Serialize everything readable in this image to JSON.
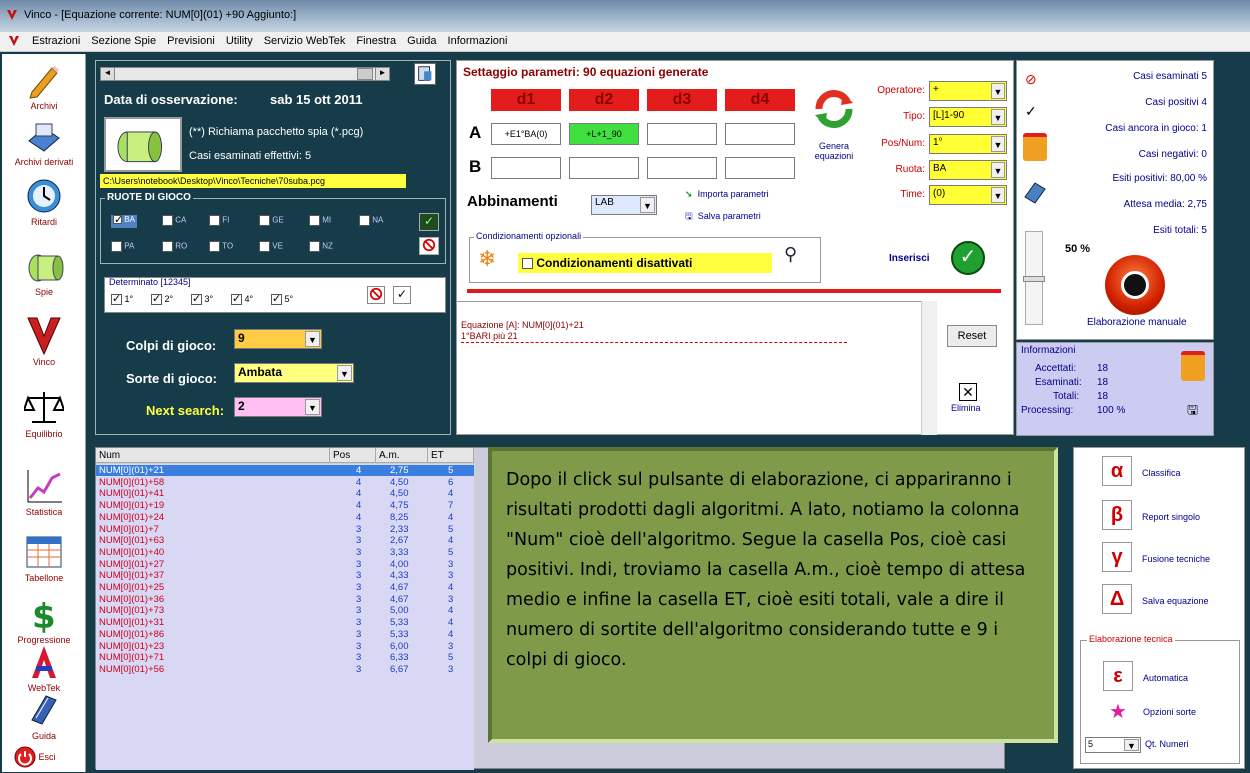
{
  "window": {
    "title": "Vinco - [Equazione corrente: NUM[0](01) +90 Aggiunto:]"
  },
  "menu": [
    "Estrazioni",
    "Sezione Spie",
    "Previsioni",
    "Utility",
    "Servizio WebTek",
    "Finestra",
    "Guida",
    "Informazioni"
  ],
  "sidebar": [
    {
      "label": "Archivi",
      "icon": "pencil-icon"
    },
    {
      "label": "Archivi derivati",
      "icon": "archive-icon"
    },
    {
      "label": "Ritardi",
      "icon": "clock-icon"
    },
    {
      "label": "Spie",
      "icon": "spy-icon"
    },
    {
      "label": "Vinco",
      "icon": "vinco-icon"
    },
    {
      "label": "Equilibrio",
      "icon": "scale-icon"
    },
    {
      "label": "Statistica",
      "icon": "chart-icon"
    },
    {
      "label": "Tabellone",
      "icon": "table-icon"
    },
    {
      "label": "Progressione",
      "icon": "dollar-icon"
    },
    {
      "label": "WebTek",
      "icon": "webtek-icon"
    },
    {
      "label": "Guida",
      "icon": "guide-icon"
    },
    {
      "label": "Esci",
      "icon": "exit-icon"
    }
  ],
  "observation": {
    "date_label": "Data di osservazione:",
    "date_value": "sab 15 ott 2011",
    "spy_pack": "(**) Richiama pacchetto spia (*.pcg)",
    "cases_examined": "Casi esaminati effettivi: 5",
    "path": "C:\\Users\\notebook\\Desktop\\Vinco\\Tecniche\\70suba.pcg",
    "ruote_title": "RUOTE DI GIOCO",
    "ruote": [
      {
        "name": "BA",
        "checked": true
      },
      {
        "name": "CA",
        "checked": false
      },
      {
        "name": "FI",
        "checked": false
      },
      {
        "name": "GE",
        "checked": false
      },
      {
        "name": "MI",
        "checked": false
      },
      {
        "name": "NA",
        "checked": false
      },
      {
        "name": "PA",
        "checked": false
      },
      {
        "name": "RO",
        "checked": false
      },
      {
        "name": "TO",
        "checked": false
      },
      {
        "name": "VE",
        "checked": false
      },
      {
        "name": "NZ",
        "checked": false
      }
    ],
    "determinato_title": "Determinato [12345]",
    "determinato": [
      "1°",
      "2°",
      "3°",
      "4°",
      "5°"
    ],
    "colpi_label": "Colpi di gioco:",
    "colpi_value": "9",
    "sorte_label": "Sorte di gioco:",
    "sorte_value": "Ambata",
    "next_label": "Next search:",
    "next_value": "2"
  },
  "settaggio": {
    "title": "Settaggio parametri: 90 equazioni generate",
    "headers": [
      "d1",
      "d2",
      "d3",
      "d4"
    ],
    "row_a_label": "A",
    "row_b_label": "B",
    "row_a": [
      "+E1°BA(0)",
      "+L+1_90",
      "",
      ""
    ],
    "genera": "Genera equazioni",
    "operatore_label": "Operatore:",
    "operatore_value": "+",
    "tipo_label": "Tipo:",
    "tipo_value": "[L]1-90",
    "posnum_label": "Pos/Num:",
    "posnum_value": "1°",
    "ruota_label": "Ruota:",
    "ruota_value": "BA",
    "time_label": "Time:",
    "time_value": "(0)",
    "abbinamenti_label": "Abbinamenti",
    "abbinamenti_value": "LAB",
    "importa": "Importa parametri",
    "salva": "Salva parametri",
    "cond_title": "Condizionamenti opzionali",
    "cond_label": "Condizionamenti disattivati",
    "inserisci": "Inserisci",
    "equation_line1": "Equazione [A]: NUM[0](01)+21",
    "equation_line2": "1°BARI  più 21",
    "reset": "Reset",
    "elimina": "Elimina"
  },
  "stats": {
    "casi_esaminati": "Casi esaminati 5",
    "casi_positivi": "Casi positivi 4",
    "casi_ancora": "Casi ancora in gioco: 1",
    "casi_negativi": "Casi negativi: 0",
    "esiti_positivi": "Esiti positivi: 80,00 %",
    "attesa_media": "Attesa media: 2,75",
    "esiti_totali": "Esiti totali: 5",
    "percent": "50 %",
    "elaborazione": "Elaborazione manuale"
  },
  "info": {
    "title": "Informazioni",
    "accettati_label": "Accettati:",
    "accettati": "18",
    "esaminati_label": "Esaminati:",
    "esaminati": "18",
    "totali_label": "Totali:",
    "totali": "18",
    "processing_label": "Processing:",
    "processing": "100 %"
  },
  "table": {
    "headers": [
      "Num",
      "Pos",
      "A.m.",
      "ET"
    ],
    "rows": [
      [
        "NUM[0](01)+21",
        "4",
        "2,75",
        "5"
      ],
      [
        "NUM[0](01)+58",
        "4",
        "4,50",
        "6"
      ],
      [
        "NUM[0](01)+41",
        "4",
        "4,50",
        "4"
      ],
      [
        "NUM[0](01)+19",
        "4",
        "4,75",
        "7"
      ],
      [
        "NUM[0](01)+24",
        "4",
        "8,25",
        "4"
      ],
      [
        "NUM[0](01)+7",
        "3",
        "2,33",
        "5"
      ],
      [
        "NUM[0](01)+63",
        "3",
        "2,67",
        "4"
      ],
      [
        "NUM[0](01)+40",
        "3",
        "3,33",
        "5"
      ],
      [
        "NUM[0](01)+27",
        "3",
        "4,00",
        "3"
      ],
      [
        "NUM[0](01)+37",
        "3",
        "4,33",
        "3"
      ],
      [
        "NUM[0](01)+25",
        "3",
        "4,67",
        "4"
      ],
      [
        "NUM[0](01)+36",
        "3",
        "4,67",
        "3"
      ],
      [
        "NUM[0](01)+73",
        "3",
        "5,00",
        "4"
      ],
      [
        "NUM[0](01)+31",
        "3",
        "5,33",
        "4"
      ],
      [
        "NUM[0](01)+86",
        "3",
        "5,33",
        "4"
      ],
      [
        "NUM[0](01)+23",
        "3",
        "6,00",
        "3"
      ],
      [
        "NUM[0](01)+71",
        "3",
        "6,33",
        "5"
      ],
      [
        "NUM[0](01)+56",
        "3",
        "6,67",
        "3"
      ]
    ]
  },
  "note": "Dopo il click sul pulsante di elaborazione, ci appariranno i risultati prodotti dagli algoritmi. A lato, notiamo la colonna \"Num\" cioè dell'algoritmo. Segue la casella Pos, cioè casi positivi. Indi, troviamo la casella A.m., cioè tempo di attesa medio e infine la casella ET, cioè esiti totali, vale a dire il numero di sortite dell'algoritmo considerando tutte e 9 i colpi di gioco.",
  "right_panel": {
    "classifica": "Classifica",
    "report": "Report singolo",
    "fusione": "Fusione tecniche",
    "salva_eq": "Salva equazione",
    "elab_title": "Elaborazione tecnica",
    "automatica": "Automatica",
    "opzioni": "Opzioni sorte",
    "qt_value": "5",
    "qt_label": "Qt. Numeri",
    "alpha": "α",
    "beta": "β",
    "gamma": "γ",
    "delta": "Δ",
    "epsilon": "ε"
  }
}
